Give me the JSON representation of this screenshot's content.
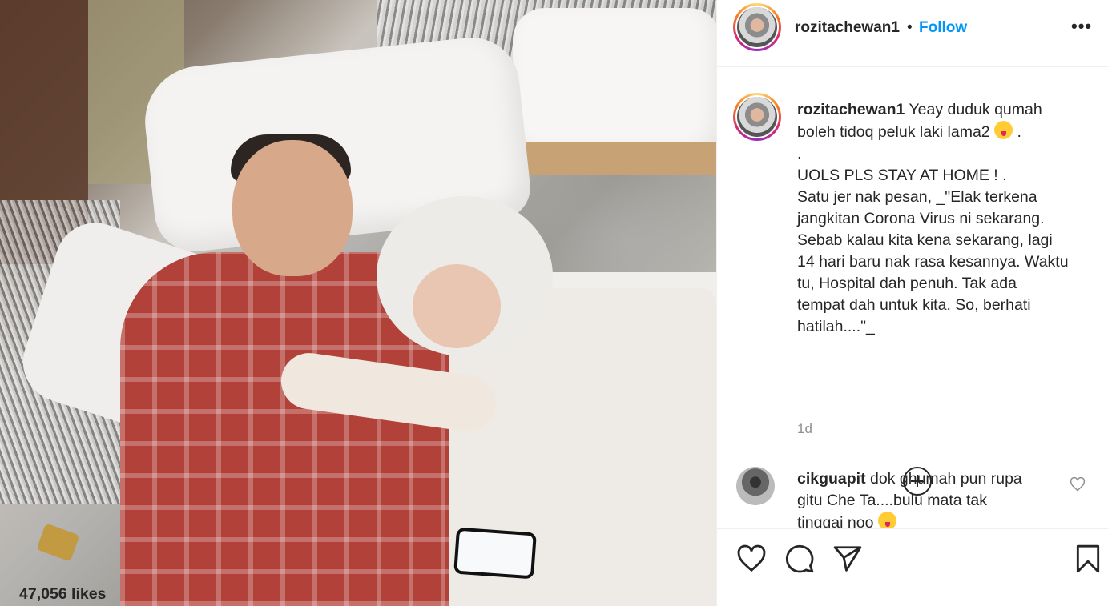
{
  "post": {
    "username": "rozitachewan1",
    "dot": "•",
    "follow_label": "Follow",
    "more_label": "•••"
  },
  "caption": {
    "username": "rozitachewan1",
    "lines": [
      "Yeay duduk qumah",
      "boleh tidoq peluk laki lama2",
      ".",
      "UOLS PLS STAY AT HOME ! .",
      "Satu jer nak pesan, _\"Elak terkena",
      "jangkitan Corona Virus ni sekarang.",
      "Sebab kalau kita kena sekarang, lagi",
      "14 hari baru nak rasa kesannya. Waktu",
      "tu, Hospital dah penuh. Tak ada",
      "tempat dah untuk kita. So, berhati",
      "hatilah....\"_"
    ],
    "emoji_suffix": ".",
    "time": "1d"
  },
  "comment": {
    "username": "cikguapit",
    "lines": [
      "dok ghumah pun rupa",
      "gitu Che Ta....bulu mata tak",
      "tinggai noo"
    ]
  },
  "likes_text": "47,056 likes",
  "icons": {
    "header_avatar": "profile-avatar-icon",
    "load_more": "plus-circle-icon",
    "like": "heart-icon",
    "comment": "speech-bubble-icon",
    "share": "paper-plane-icon",
    "save": "bookmark-icon"
  },
  "colors": {
    "follow": "#0095f6",
    "text": "#262626",
    "muted": "#8e8e8e",
    "border": "#efefef"
  }
}
